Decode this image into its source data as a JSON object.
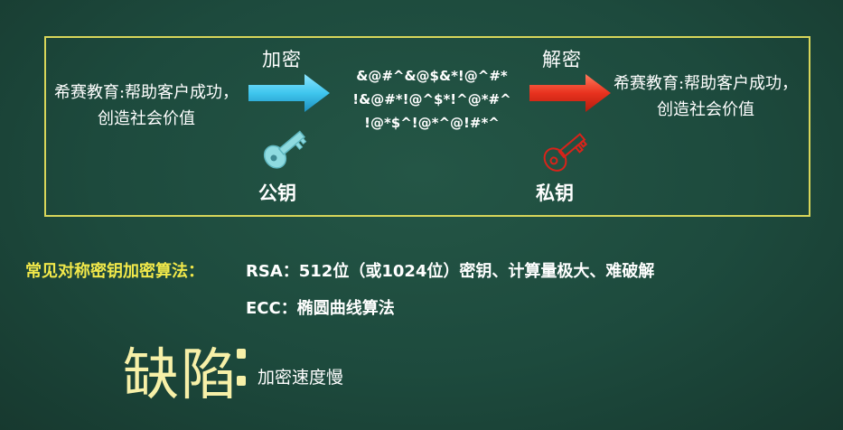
{
  "diagram": {
    "plaintext_left": "希赛教育:帮助客户成功，创造社会价值",
    "plaintext_right": "希赛教育:帮助客户成功，创造社会价值",
    "encrypt_label": "加密",
    "decrypt_label": "解密",
    "ciphertext": [
      "&@#^&@$&*!@^#*",
      "!&@#*!@^$*!^@*#^",
      "!@*$^!@*^@!#*^"
    ],
    "public_key_label": "公钥",
    "private_key_label": "私钥",
    "icons": {
      "encrypt_arrow": "arrow-right-icon",
      "decrypt_arrow": "arrow-right-icon",
      "public_key": "key-icon",
      "private_key": "key-icon"
    },
    "colors": {
      "border": "#d8d65a",
      "encrypt_arrow": "#3fc6ee",
      "decrypt_arrow": "#e8321e",
      "public_key": "#8fdbe0",
      "private_key": "#d9231a"
    }
  },
  "algorithms": {
    "title": "常见对称密钥加密算法：",
    "rsa": "RSA：512位（或1024位）密钥、计算量极大、难破解",
    "ecc": "ECC：椭圆曲线算法",
    "title_color": "#f1e84a"
  },
  "defect": {
    "title": "缺陷",
    "text": "加密速度慢",
    "title_color": "#f7f0a8"
  },
  "background_color": "#1d4a3d"
}
